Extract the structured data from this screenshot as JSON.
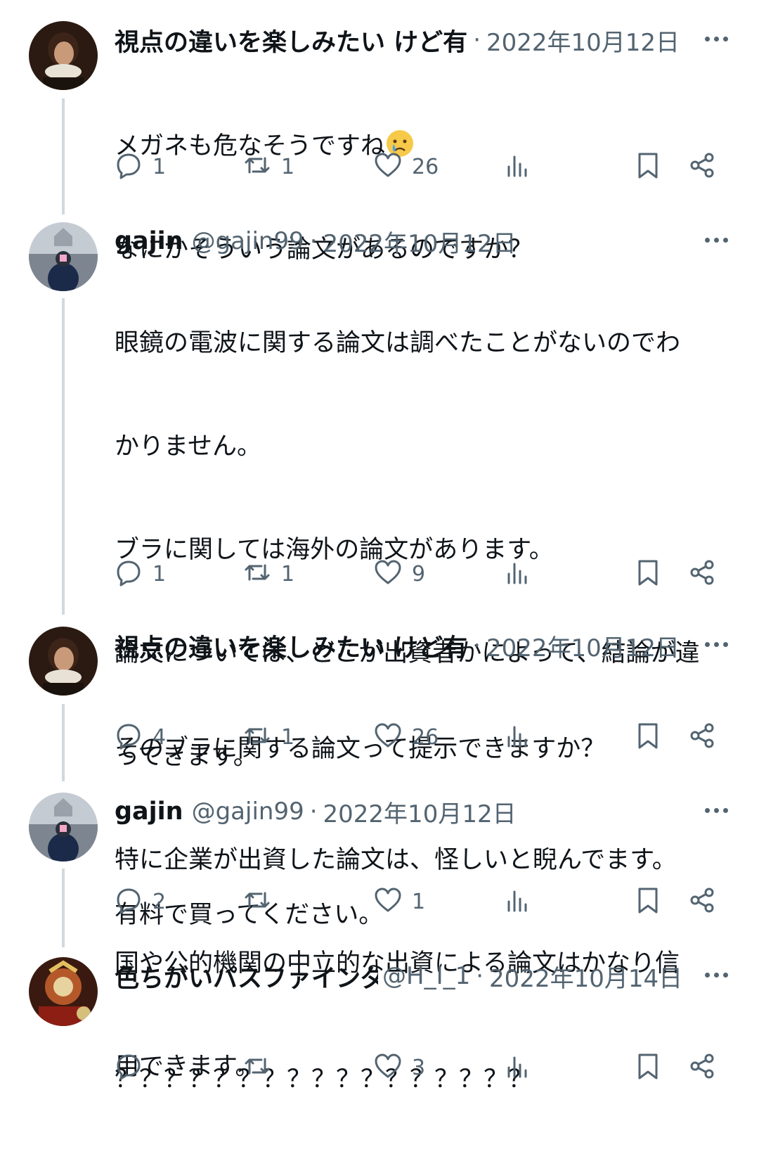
{
  "tweets": [
    {
      "name": "視点の違いを楽しみたい けど有",
      "handle": "",
      "date": "2022年10月12日",
      "lines": [
        "メガネも危なそうですね",
        "なにかそういう論文があるのですか？"
      ],
      "emoji": "crying-face",
      "replies": "1",
      "retweets": "1",
      "likes": "26"
    },
    {
      "name": "gajin",
      "handle": "@gajin99",
      "date": "2022年10月12日",
      "lines": [
        "眼鏡の電波に関する論文は調べたことがないのでわ",
        "かりません。",
        "ブラに関しては海外の論文があります。",
        "論文については、どこが出資者かによって、結論が違",
        "ってきます。",
        "特に企業が出資した論文は、怪しいと睨んでます。",
        "国や公的機関の中立的な出資による論文はかなり信",
        "用できます。"
      ],
      "replies": "1",
      "retweets": "1",
      "likes": "9"
    },
    {
      "name": "視点の違いを楽しみたい けど有",
      "handle": "",
      "date": "2022年10月12日",
      "lines": [
        "そのブラに関する論文って提示できますか？"
      ],
      "replies": "4",
      "retweets": "1",
      "likes": "26"
    },
    {
      "name": "gajin",
      "handle": "@gajin99",
      "date": "2022年10月12日",
      "lines": [
        "有料で買ってください。"
      ],
      "replies": "2",
      "retweets": "",
      "likes": "1"
    },
    {
      "name": "色ちがいパスファインダ",
      "handle": "@H_I_1",
      "date": "2022年10月14日",
      "lines": [
        "？？？？？？？？？？？？？？？？？"
      ],
      "replies": "",
      "retweets": "",
      "likes": "3"
    }
  ],
  "colors": {
    "secondary_text": "#536471",
    "thread_line": "#cfd9de",
    "primary_text": "#0f1419"
  },
  "icons": [
    "reply-icon",
    "retweet-icon",
    "like-icon",
    "views-icon",
    "bookmark-icon",
    "share-icon",
    "more-icon"
  ]
}
